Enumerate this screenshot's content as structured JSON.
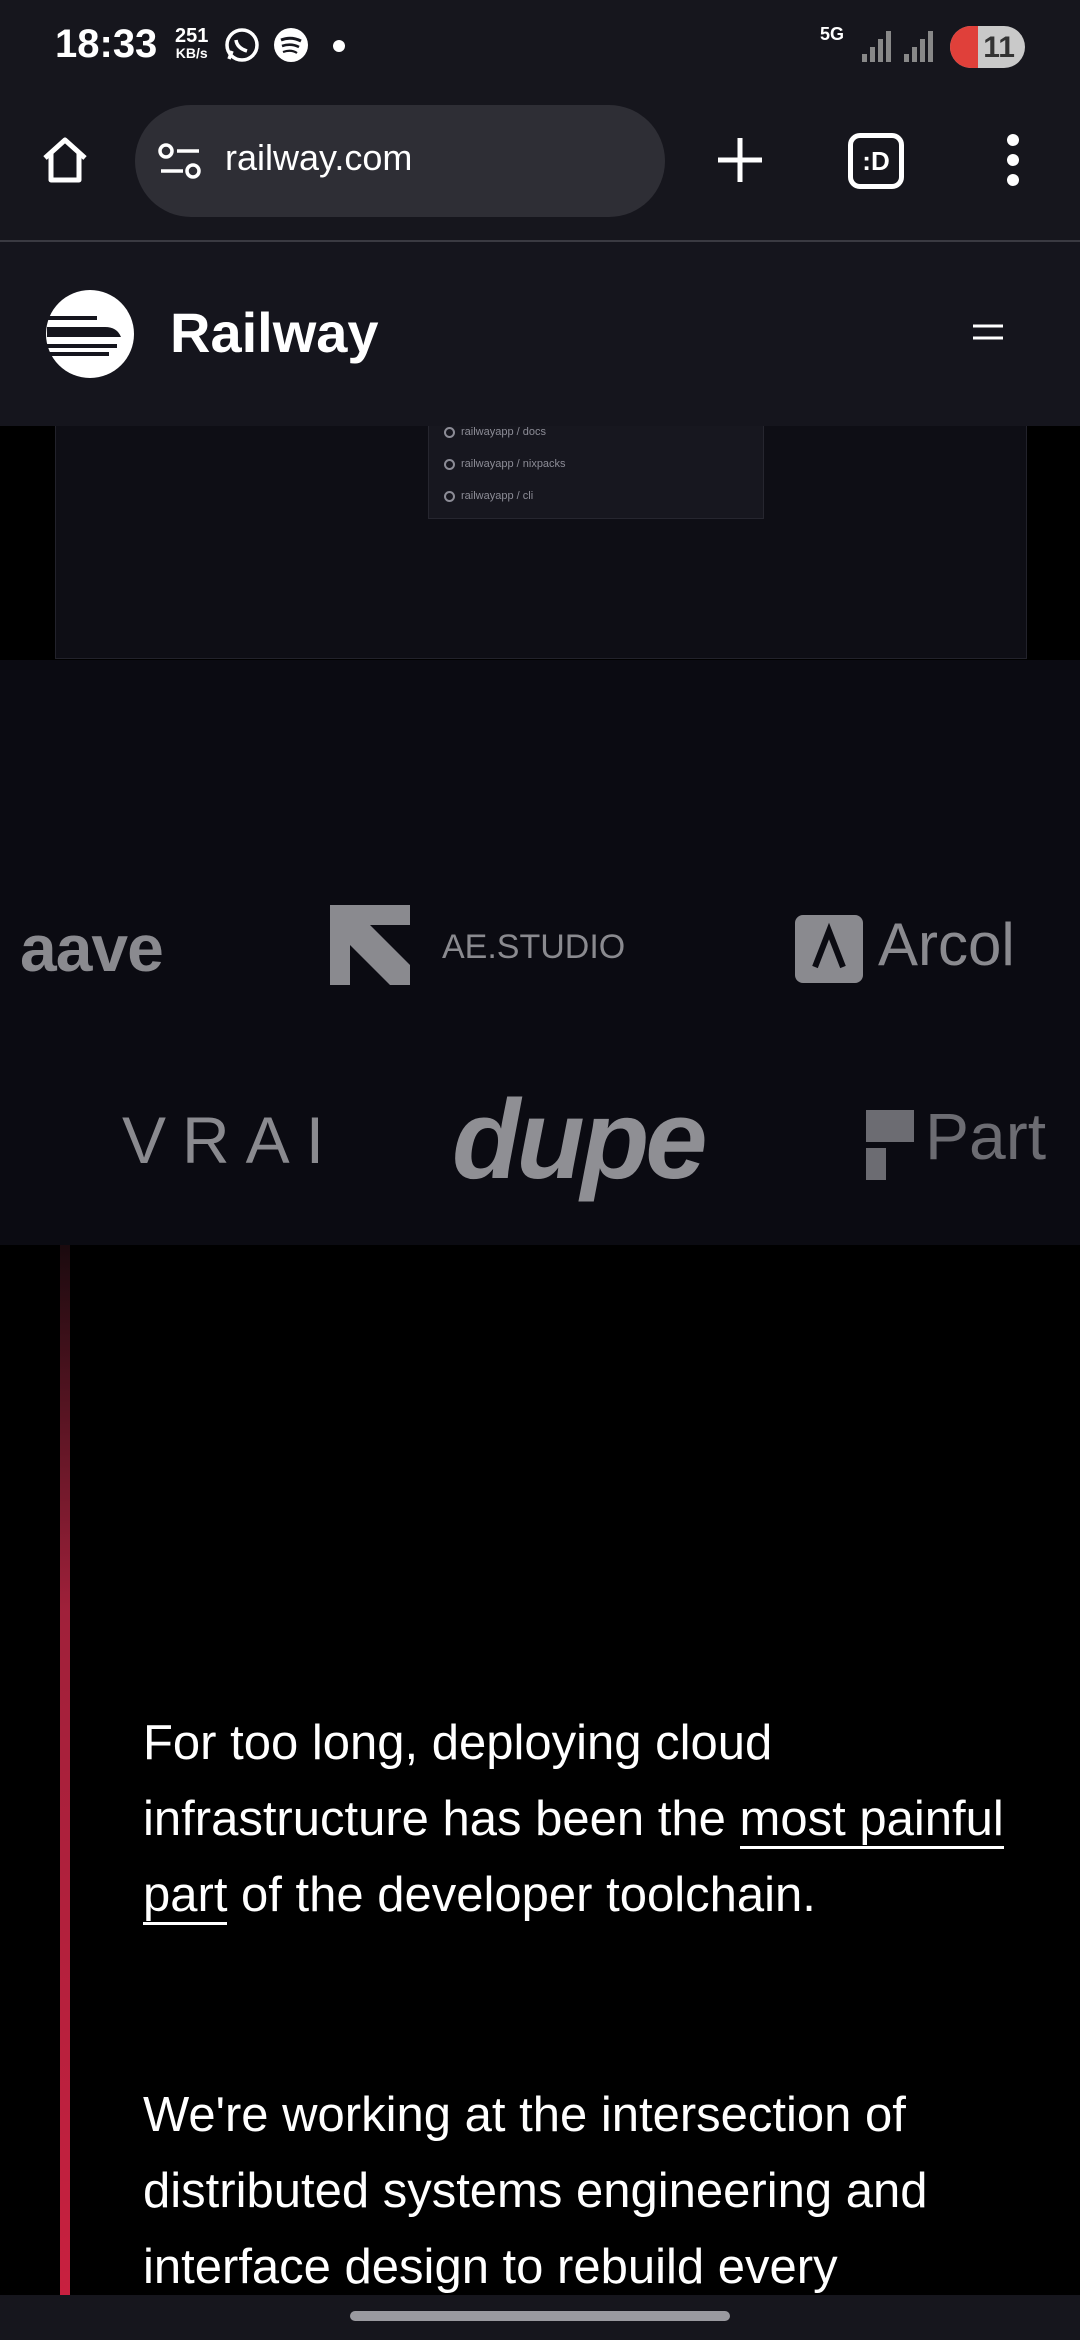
{
  "status_bar": {
    "time": "18:33",
    "net_speed_value": "251",
    "net_speed_unit": "KB/s",
    "network": "5G",
    "battery": "11",
    "icons": [
      "whatsapp-icon",
      "spotify-icon",
      "notification-dot-icon",
      "signal-icon",
      "battery-icon"
    ]
  },
  "browser": {
    "url": "railway.com",
    "icons": [
      "home-icon",
      "site-settings-icon",
      "new-tab-icon",
      "tab-switcher-icon",
      "more-icon"
    ],
    "tab_switcher_label": ":D"
  },
  "site": {
    "brand": "Railway",
    "repos": [
      "railwayapp / docs",
      "railwayapp / nixpacks",
      "railwayapp / cli"
    ],
    "customer_logos_row1": [
      "aave",
      "AE.STUDIO",
      "Arcol"
    ],
    "customer_logos_row2": [
      "VRAI",
      "dupe",
      "Part"
    ],
    "mission": {
      "p1_before": "For too long, deploying cloud infrastructure has been the ",
      "p1_link": "most painful part",
      "p1_after": " of the developer toolchain.",
      "p2": "We're working at the intersection of distributed systems engineering and interface design to rebuild every"
    }
  }
}
